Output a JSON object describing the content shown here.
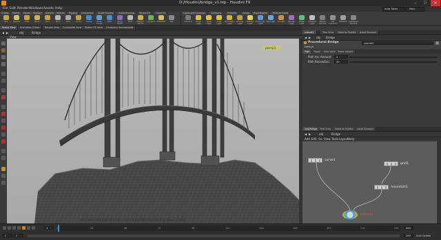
{
  "window": {
    "title": "D:/Houdini/bridge_v1.hip - Houdini FX",
    "controls": [
      "–",
      "□",
      "✕"
    ]
  },
  "menu": [
    "File",
    "Edit",
    "Render",
    "Windows",
    "Assets",
    "Help"
  ],
  "shelf": {
    "tabs": [
      "Create",
      "Modify",
      "Model",
      "Polygon",
      "Deform",
      "Texture",
      "Rigging",
      "Characters",
      "Guide Process",
      "Guide Brushes",
      "Terrain FX",
      "Cloud FX",
      "Volume",
      "Lights and Cameras",
      "Collisions",
      "Particles",
      "Grains",
      "Rigid Bodies",
      "Particle Fluids",
      "Viscous Fluids",
      "Oceans",
      "Fluid Containers",
      "Populate Containers",
      "Container Tools",
      "Pyro FX",
      "FEM",
      "Wires",
      "Crowds",
      "Drive Simulation"
    ],
    "tools": [
      {
        "label": "Box",
        "color": "#c9a23a"
      },
      {
        "label": "Sphere",
        "color": "#d9c05c"
      },
      {
        "label": "Tube",
        "color": "#c9a23a"
      },
      {
        "label": "Torus",
        "color": "#d2b04a"
      },
      {
        "label": "Grid",
        "color": "#c9a23a"
      },
      {
        "label": "Null",
        "color": "#b8b8b8"
      },
      {
        "label": "Line",
        "color": "#a9a9a9"
      },
      {
        "label": "Circle",
        "color": "#c9a23a"
      },
      {
        "label": "Curve",
        "color": "#3b8fd6"
      },
      {
        "label": "Draw Curve",
        "color": "#5a9fd9"
      },
      {
        "label": "Path",
        "color": "#4a8fc9"
      },
      {
        "label": "Spray Paint",
        "color": "#8e6bc9"
      },
      {
        "label": "Font",
        "color": "#b8b8b8"
      },
      {
        "label": "Platonic Solids",
        "color": "#d2b04a"
      },
      {
        "label": "L-System",
        "color": "#6bb35a"
      },
      {
        "label": "Metaball",
        "color": "#d9c05c"
      },
      {
        "label": "File",
        "color": "#8a8a8a"
      }
    ],
    "right_tools": [
      {
        "label": "Camera",
        "color": "#7a7a7a"
      },
      {
        "label": "Point Light",
        "color": "#e0c040"
      },
      {
        "label": "Spot Light",
        "color": "#e0c040"
      },
      {
        "label": "Area Light",
        "color": "#e0c040"
      },
      {
        "label": "Geometry Light",
        "color": "#d0b040"
      },
      {
        "label": "Volume Light",
        "color": "#c0a040"
      },
      {
        "label": "Distant Light",
        "color": "#e8d050"
      },
      {
        "label": "Environment Light",
        "color": "#5aa0d0"
      },
      {
        "label": "Sky Light",
        "color": "#60a8e0"
      },
      {
        "label": "GI Light",
        "color": "#d09040"
      },
      {
        "label": "Caustic Light",
        "color": "#a070c0"
      },
      {
        "label": "Portal Light",
        "color": "#60c080"
      },
      {
        "label": "Ambient Light",
        "color": "#c0c0c0"
      },
      {
        "label": "Stereo Camera",
        "color": "#808080"
      },
      {
        "label": "VR Camera",
        "color": "#909090"
      },
      {
        "label": "Switcher",
        "color": "#a0a0a0"
      },
      {
        "label": "Gamepad Camera",
        "color": "#888888"
      }
    ],
    "right_tabs": [
      "Lights and Cameras",
      "Collisions",
      "Particles",
      "Grains",
      "Rigid Bodies",
      "Particle Fluids"
    ]
  },
  "auto_update": "Auto Takes",
  "desktop": "Main",
  "viewport_tabs": [
    "Scene View",
    "Animation Editor",
    "Render View",
    "Composite View",
    "Motion FX View",
    "Geometry Spreadsheet"
  ],
  "viewport_path": {
    "context": "obj",
    "node": "Bridge"
  },
  "viewport_header": "View",
  "viewport_camera": "persp1",
  "status_message": "LMB Tumble   MMB Track   RMB Dolly   Ctrl+LMB Box Zoom   Alt+LMB Dolly   Space: Viewport",
  "params": {
    "tabs": [
      "Tree View",
      "Material Palette",
      "Asset Browser"
    ],
    "path": {
      "context": "obj",
      "node": "Bridge"
    },
    "node_type": "Procedural Bridge",
    "node_name": "subnet1",
    "section": "Default",
    "param_tabs": [
      "Path",
      "Road",
      "Side Walk",
      "Tower Height"
    ],
    "fields": [
      {
        "label": "Path Arc Amount",
        "value": "2"
      },
      {
        "label": "Path Resolution",
        "value": "20"
      }
    ]
  },
  "network": {
    "tabs": [
      "/obj/Bridge",
      "Tree View",
      "Material Palette",
      "Asset Browser"
    ],
    "path": {
      "context": "obj",
      "node": "Bridge"
    },
    "menus": [
      "Add",
      "Edit",
      "Go",
      "View",
      "Tools",
      "Layout",
      "Help"
    ],
    "nodes": [
      {
        "name": "curve1"
      },
      {
        "name": "grid1"
      },
      {
        "name": "mountain1"
      },
      {
        "name": "subnet1"
      }
    ]
  },
  "timeline": {
    "current_frame": "1",
    "start": "1",
    "end": "240",
    "ticks": [
      "1",
      "24",
      "48",
      "72",
      "96",
      "120",
      "144",
      "168",
      "192",
      "216",
      "240"
    ],
    "range_start": "1",
    "range_end": "240",
    "auto_update": "Auto Update"
  }
}
